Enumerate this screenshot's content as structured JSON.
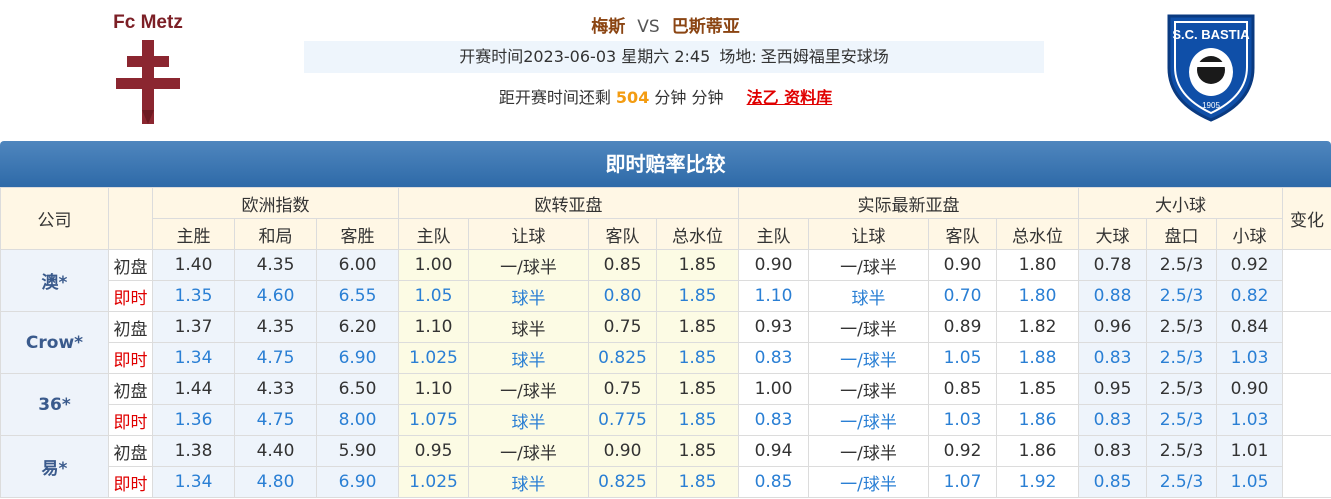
{
  "match": {
    "home_logo_text": "Fc Metz",
    "away_logo_text": "S.C. BASTIA",
    "away_logo_year": "1905",
    "home": "梅斯",
    "vs": "VS",
    "away": "巴斯蒂亚",
    "kickoff_label": "开赛时间2023-06-03 星期六 2:45",
    "venue_label": "场地:",
    "venue": "圣西姆福里安球场",
    "countdown_prefix": "距开赛时间还剩",
    "countdown_minutes": "504",
    "countdown_suffix": "分钟 分钟",
    "league_link": "法乙 资料库"
  },
  "odds_table": {
    "title": "即时赔率比较",
    "headers": {
      "company": "公司",
      "european": "欧洲指数",
      "euro_to_asian": "欧转亚盘",
      "actual_asian": "实际最新亚盘",
      "over_under": "大小球",
      "change": "变化",
      "home_win": "主胜",
      "draw": "和局",
      "away_win": "客胜",
      "home_team": "主队",
      "handicap": "让球",
      "away_team": "客队",
      "total_water": "总水位",
      "big_ball": "大球",
      "line": "盘口",
      "small_ball": "小球"
    },
    "type_labels": {
      "initial": "初盘",
      "live": "即时"
    },
    "rows": [
      {
        "company": "澳*",
        "initial": {
          "home": "1.40",
          "draw": "4.35",
          "away": "6.00",
          "e_home": "1.00",
          "e_hcp": "一/球半",
          "e_away": "0.85",
          "e_total": "1.85",
          "a_home": "0.90",
          "a_hcp": "一/球半",
          "a_away": "0.90",
          "a_total": "1.80",
          "big": "0.78",
          "line": "2.5/3",
          "small": "0.92"
        },
        "live": {
          "home": "1.35",
          "draw": "4.60",
          "away": "6.55",
          "e_home": "1.05",
          "e_hcp": "球半",
          "e_away": "0.80",
          "e_total": "1.85",
          "a_home": "1.10",
          "a_hcp": "球半",
          "a_away": "0.70",
          "a_total": "1.80",
          "big": "0.88",
          "line": "2.5/3",
          "small": "0.82"
        }
      },
      {
        "company": "Crow*",
        "initial": {
          "home": "1.37",
          "draw": "4.35",
          "away": "6.20",
          "e_home": "1.10",
          "e_hcp": "球半",
          "e_away": "0.75",
          "e_total": "1.85",
          "a_home": "0.93",
          "a_hcp": "一/球半",
          "a_away": "0.89",
          "a_total": "1.82",
          "big": "0.96",
          "line": "2.5/3",
          "small": "0.84"
        },
        "live": {
          "home": "1.34",
          "draw": "4.75",
          "away": "6.90",
          "e_home": "1.025",
          "e_hcp": "球半",
          "e_away": "0.825",
          "e_total": "1.85",
          "a_home": "0.83",
          "a_hcp": "一/球半",
          "a_away": "1.05",
          "a_total": "1.88",
          "big": "0.83",
          "line": "2.5/3",
          "small": "1.03"
        }
      },
      {
        "company": "36*",
        "initial": {
          "home": "1.44",
          "draw": "4.33",
          "away": "6.50",
          "e_home": "1.10",
          "e_hcp": "一/球半",
          "e_away": "0.75",
          "e_total": "1.85",
          "a_home": "1.00",
          "a_hcp": "一/球半",
          "a_away": "0.85",
          "a_total": "1.85",
          "big": "0.95",
          "line": "2.5/3",
          "small": "0.90"
        },
        "live": {
          "home": "1.36",
          "draw": "4.75",
          "away": "8.00",
          "e_home": "1.075",
          "e_hcp": "球半",
          "e_away": "0.775",
          "e_total": "1.85",
          "a_home": "0.83",
          "a_hcp": "一/球半",
          "a_away": "1.03",
          "a_total": "1.86",
          "big": "0.83",
          "line": "2.5/3",
          "small": "1.03"
        }
      },
      {
        "company": "易*",
        "initial": {
          "home": "1.38",
          "draw": "4.40",
          "away": "5.90",
          "e_home": "0.95",
          "e_hcp": "一/球半",
          "e_away": "0.90",
          "e_total": "1.85",
          "a_home": "0.94",
          "a_hcp": "一/球半",
          "a_away": "0.92",
          "a_total": "1.86",
          "big": "0.83",
          "line": "2.5/3",
          "small": "1.01"
        },
        "live": {
          "home": "1.34",
          "draw": "4.80",
          "away": "6.90",
          "e_home": "1.025",
          "e_hcp": "球半",
          "e_away": "0.825",
          "e_total": "1.85",
          "a_home": "0.85",
          "a_hcp": "一/球半",
          "a_away": "1.07",
          "a_total": "1.92",
          "big": "0.85",
          "line": "2.5/3",
          "small": "1.05"
        }
      }
    ]
  },
  "colors": {
    "title_bar": "#2e6aa8",
    "header_bg": "#fff7e5",
    "live_label": "#e00000",
    "live_value": "#2a7fd4",
    "countdown_number": "#f39c12",
    "team_name": "#8b4513"
  }
}
